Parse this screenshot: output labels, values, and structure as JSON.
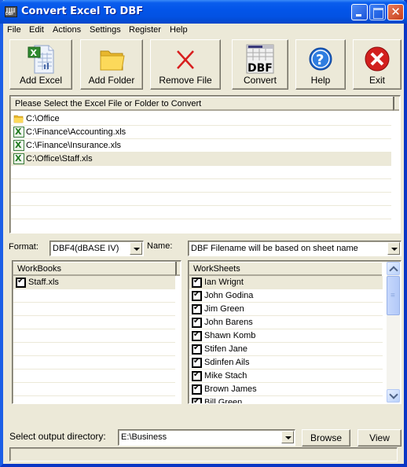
{
  "window": {
    "title": "Convert Excel To DBF"
  },
  "menu": [
    "File",
    "Edit",
    "Actions",
    "Settings",
    "Register",
    "Help"
  ],
  "toolbar": {
    "add_excel": "Add Excel",
    "add_folder": "Add Folder",
    "remove_file": "Remove File",
    "convert": "Convert",
    "help": "Help",
    "exit": "Exit"
  },
  "file_list": {
    "header": "Please Select the Excel File or Folder to Convert",
    "items": [
      {
        "type": "folder",
        "path": "C:\\Office"
      },
      {
        "type": "xls",
        "path": "C:\\Finance\\Accounting.xls"
      },
      {
        "type": "xls",
        "path": "C:\\Finance\\Insurance.xls"
      },
      {
        "type": "xls",
        "path": "C:\\Office\\Staff.xls",
        "selected": true
      }
    ]
  },
  "options": {
    "format_label": "Format:",
    "format_value": "DBF4(dBASE IV)",
    "name_label": "Name:",
    "name_value": "DBF Filename will be based on sheet name"
  },
  "workbooks": {
    "header": "WorkBooks",
    "items": [
      {
        "name": "Staff.xls",
        "checked": true
      }
    ]
  },
  "worksheets": {
    "header": "WorkSheets",
    "items": [
      {
        "name": "Ian Wrignt",
        "checked": true
      },
      {
        "name": "John Godina",
        "checked": true
      },
      {
        "name": "Jim Green",
        "checked": true
      },
      {
        "name": "John Barens",
        "checked": true
      },
      {
        "name": "Shawn Komb",
        "checked": true
      },
      {
        "name": "Stifen Jane",
        "checked": true
      },
      {
        "name": "Sdinfen Ails",
        "checked": true
      },
      {
        "name": "Mike Stach",
        "checked": true
      },
      {
        "name": "Brown James",
        "checked": true
      },
      {
        "name": "Bill Green",
        "checked": true
      }
    ]
  },
  "output": {
    "label": "Select  output directory:",
    "directory": "E:\\Business",
    "browse": "Browse",
    "view": "View"
  },
  "status": {
    "text": ""
  }
}
